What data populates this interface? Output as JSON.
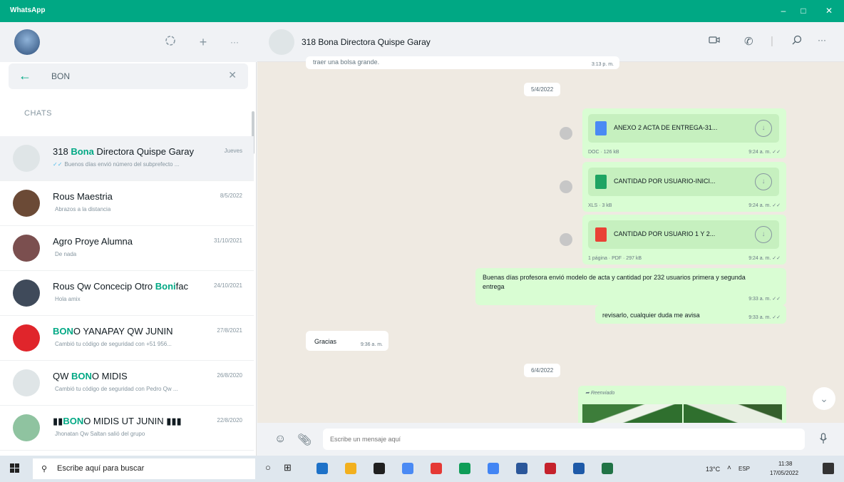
{
  "window": {
    "title": "WhatsApp",
    "controls": [
      "–",
      "□",
      "✕"
    ]
  },
  "left": {
    "header_icons": [
      "status-icon",
      "new-chat-icon",
      "menu-icon"
    ],
    "search": {
      "value": "BON",
      "back_icon": "arrow-left-icon",
      "clear_icon": "close-icon"
    },
    "section_label": "CHATS",
    "chats": [
      {
        "name_parts": [
          "318 ",
          "Bona",
          " Directora Quispe Garay"
        ],
        "date": "Jueves",
        "preview": "Buenos días envió número del subprefecto ...",
        "ticks": "✓✓",
        "active": true,
        "avatar_color": "#dfe5e7"
      },
      {
        "name_parts": [
          "Rous Maestria",
          "",
          ""
        ],
        "date": "8/5/2022",
        "preview": "Abrazos a la distancia",
        "ticks": "",
        "active": false,
        "avatar_color": "#6b4a36"
      },
      {
        "name_parts": [
          "Agro Proye Alumna",
          "",
          ""
        ],
        "date": "31/10/2021",
        "preview": "De nada",
        "ticks": "",
        "active": false,
        "avatar_color": "#7b4f4f"
      },
      {
        "name_parts": [
          "Rous Qw Concecip Otro ",
          "Boni",
          "fac"
        ],
        "date": "24/10/2021",
        "preview": "Hola amix",
        "ticks": "",
        "active": false,
        "avatar_color": "#3f4a5a"
      },
      {
        "name_parts": [
          "",
          "BON",
          "O YANAPAY QW JUNIN"
        ],
        "date": "27/8/2021",
        "preview": "Cambió tu código de seguridad con +51 956...",
        "ticks": "",
        "active": false,
        "avatar_color": "#e0252b"
      },
      {
        "name_parts": [
          "QW ",
          "BON",
          "O MIDIS"
        ],
        "date": "26/8/2020",
        "preview": "Cambió tu código de seguridad con Pedro Qw ...",
        "ticks": "",
        "active": false,
        "avatar_color": "#dfe5e7"
      },
      {
        "name_parts": [
          "▮▮",
          "BON",
          "O MIDIS UT JUNIN ▮▮▮"
        ],
        "date": "22/8/2020",
        "preview": "Jhonatan Qw Saltan salió del grupo",
        "ticks": "",
        "active": false,
        "avatar_color": "#8fc3a0"
      }
    ]
  },
  "right": {
    "contact_name": "318 Bona Directora Quispe Garay",
    "header_icons": [
      "video-call-icon",
      "voice-call-icon",
      "search-icon",
      "menu-icon"
    ],
    "top_partial": {
      "text": "traer una bolsa grande.",
      "time": "3:13 p. m."
    },
    "date1": "5/4/2022",
    "docs": [
      {
        "name": "ANEXO 2 ACTA DE ENTREGA-31...",
        "meta": "DOC · 126 kB",
        "time": "9:24 a. m. ✓✓",
        "color": "#4a8af4"
      },
      {
        "name": "CANTIDAD POR USUARIO-INICI...",
        "meta": "XLS · 3 kB",
        "time": "9:24 a. m. ✓✓",
        "color": "#1fa463"
      },
      {
        "name": "CANTIDAD POR USUARIO 1 Y 2...",
        "meta": "1 página · PDF · 297 kB",
        "time": "9:24 a. m. ✓✓",
        "color": "#e94235"
      }
    ],
    "msg1": {
      "text": "Buenas días profesora envió modelo de acta y cantidad por 232 usuarios primera y segunda entrega",
      "time": "9:33 a. m. ✓✓"
    },
    "msg2": {
      "text": "revisarlo, cualquier duda me avisa",
      "time": "9:33 a. m. ✓✓"
    },
    "incoming": {
      "text": "Gracias",
      "time": "9:36 a. m."
    },
    "date2": "6/4/2022",
    "forwarded_label": "Reenviado",
    "composer_placeholder": "Escribe un mensaje aquí",
    "composer_icons": [
      "emoji-icon",
      "attach-icon",
      "mic-icon"
    ]
  },
  "taskbar": {
    "search_placeholder": "Escribe aquí para buscar",
    "weather": "13°C",
    "lang": "ESP",
    "time": "11:38",
    "date": "17/05/2022",
    "apps": [
      "#1e72c8",
      "#f2b01e",
      "#202020",
      "#4a8af4",
      "#e53935",
      "#0f9d58",
      "#4285f4",
      "#2b579a",
      "#c5222c",
      "#1e5aa8",
      "#217346"
    ]
  }
}
